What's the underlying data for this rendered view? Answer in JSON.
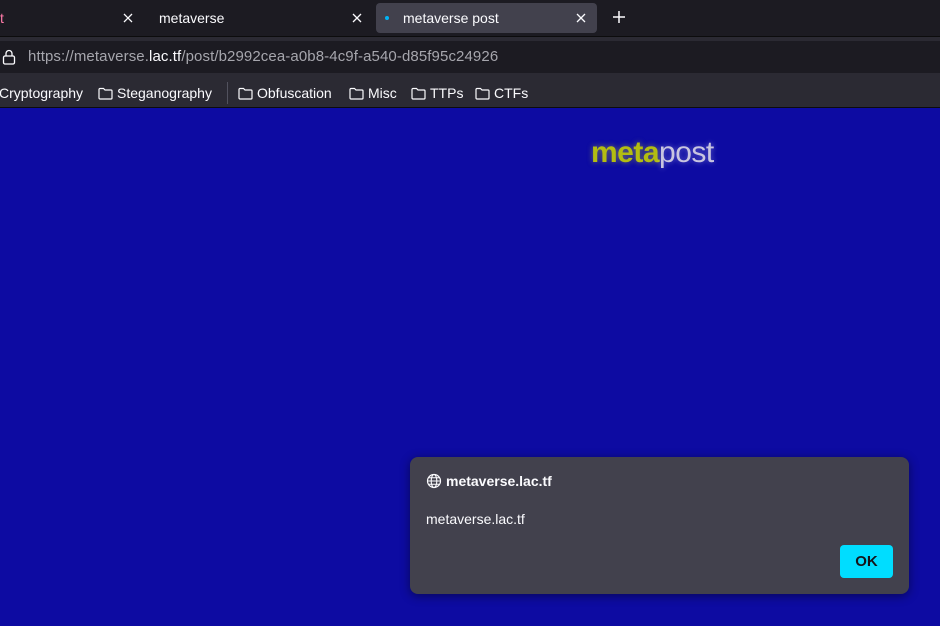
{
  "tabs": [
    {
      "title": "t",
      "active": false
    },
    {
      "title": "metaverse",
      "active": false
    },
    {
      "title": "metaverse post",
      "active": true
    }
  ],
  "icons": {
    "close": "close-icon",
    "new_tab": "plus-icon",
    "lock": "lock-icon",
    "folder": "folder-icon",
    "globe": "globe-icon"
  },
  "url": {
    "prefix": "https://metaverse.",
    "domain": "lac.tf",
    "path": "/post/b2992cea-a0b8-4c9f-a540-d85f95c24926"
  },
  "bookmarks": [
    {
      "label": "Cryptography"
    },
    {
      "label": "Steganography"
    },
    {
      "label": "Obfuscation"
    },
    {
      "label": "Misc"
    },
    {
      "label": "TTPs"
    },
    {
      "label": "CTFs"
    }
  ],
  "page": {
    "logo_part1": "meta",
    "logo_part2": "post",
    "background": "#0d0ba2"
  },
  "dialog": {
    "origin": "metaverse.lac.tf",
    "message": "metaverse.lac.tf",
    "ok_label": "OK",
    "button_color": "#00ddff"
  }
}
